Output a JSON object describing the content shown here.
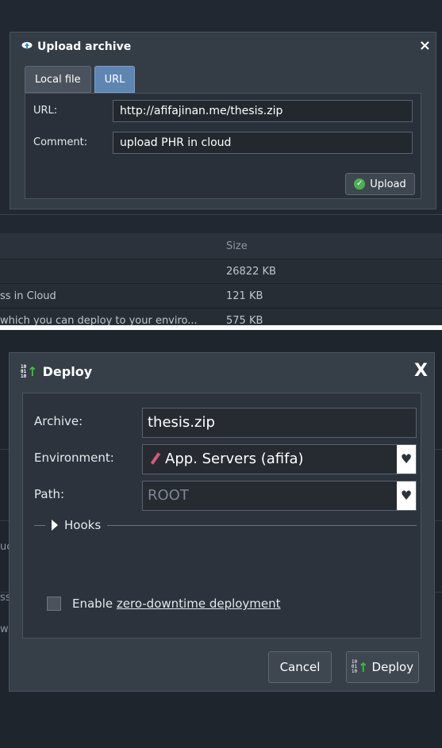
{
  "upload_dialog": {
    "title": "Upload archive",
    "close_label": "×",
    "tabs": [
      {
        "label": "Local file",
        "active": false
      },
      {
        "label": "URL",
        "active": true
      }
    ],
    "url_label": "URL:",
    "url_value": "http://afifajinan.me/thesis.zip",
    "comment_label": "Comment:",
    "comment_value": "upload PHR in cloud",
    "upload_button": "Upload"
  },
  "file_list": {
    "size_header": "Size",
    "rows": [
      {
        "name": "",
        "size": "26822 KB"
      },
      {
        "name": "ss in Cloud",
        "size": "121 KB"
      },
      {
        "name": "which you can deploy to your enviro...",
        "size": "575 KB"
      }
    ]
  },
  "deploy_dialog": {
    "title": "Deploy",
    "close_label": "X",
    "archive_label": "Archive:",
    "archive_value": "thesis.zip",
    "environment_label": "Environment:",
    "environment_value": "App. Servers (afifa)",
    "path_label": "Path:",
    "path_value": "ROOT",
    "hooks_label": "Hooks",
    "zero_downtime_prefix": "Enable ",
    "zero_downtime_link": "zero-downtime deployment",
    "zero_downtime_checked": false,
    "cancel_button": "Cancel",
    "deploy_button": "Deploy"
  },
  "background_fragments": [
    "uc",
    "ss",
    "w"
  ],
  "colors": {
    "accent_tab": "#5e86b3",
    "ok_green": "#4caf50",
    "deploy_arrow": "#35c43a",
    "env_icon": "#d8577a"
  }
}
